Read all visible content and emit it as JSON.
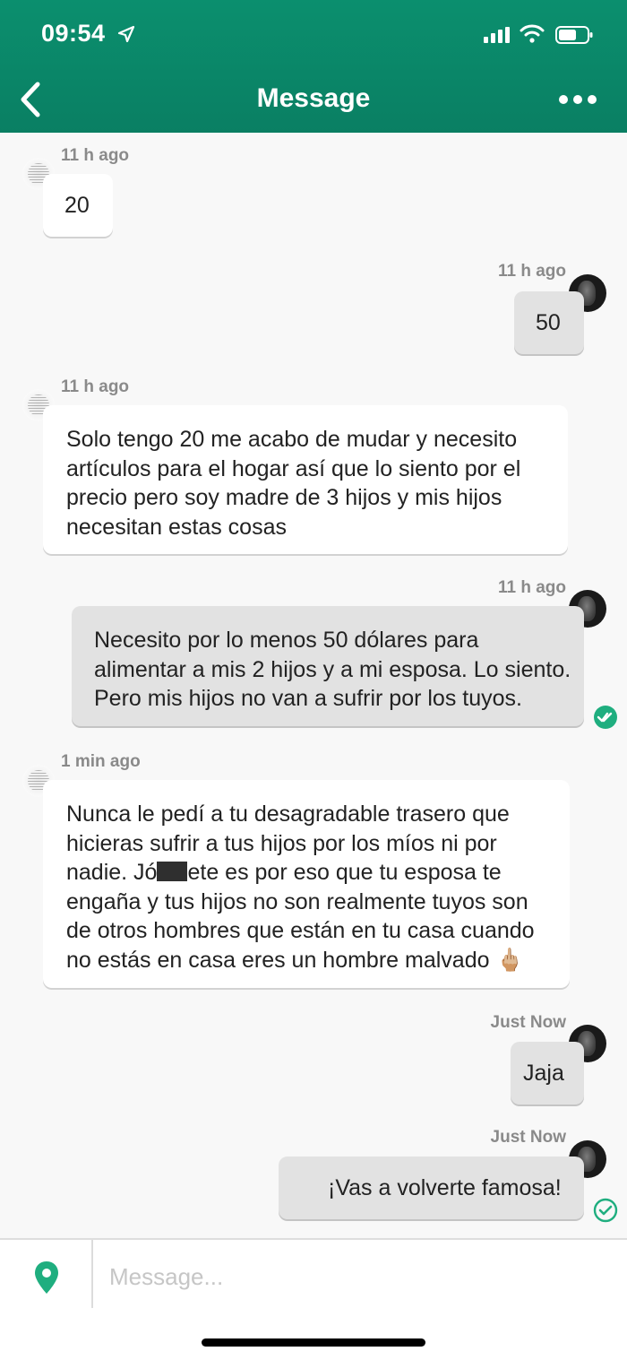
{
  "status_bar": {
    "time": "09:54"
  },
  "header": {
    "title": "Message"
  },
  "messages": [
    {
      "side": "in",
      "time": "11 h ago",
      "text": "20"
    },
    {
      "side": "out",
      "time": "11 h ago",
      "text": "50"
    },
    {
      "side": "in",
      "time": "11 h ago",
      "lines": [
        "Solo tengo 20 me acabo de mudar y necesito",
        "artículos para el hogar así que lo siento por el",
        "precio pero soy madre de 3 hijos y mis hijos",
        "necesitan estas cosas"
      ]
    },
    {
      "side": "out",
      "time": "11 h ago",
      "lines": [
        "Necesito por lo menos 50 dólares para",
        "alimentar a mis 2 hijos y a mi esposa. Lo siento.",
        "Pero mis hijos no van a sufrir por los tuyos."
      ],
      "status": "read"
    },
    {
      "side": "in",
      "time": "1 min ago",
      "lines": [
        "Nunca le pedí a tu desagradable trasero que",
        "hicieras sufrir a tus hijos por los míos ni por",
        "nadie. Jó",
        "ete es por eso que tu esposa te",
        "engaña y tus hijos no son realmente tuyos son",
        "de otros hombres que están en tu casa cuando",
        "no estás en casa eres un hombre malvado",
        "🖕🏼"
      ]
    },
    {
      "side": "out",
      "time": "Just Now",
      "text": "Jaja"
    },
    {
      "side": "out",
      "time": "Just Now",
      "text": "¡Vas a volverte famosa!",
      "status": "sent"
    }
  ],
  "composer": {
    "placeholder": "Message..."
  },
  "colors": {
    "header": "#0a8a6a",
    "accent_green": "#1fae7f"
  },
  "icons": [
    "location-arrow-icon",
    "signal-icon",
    "wifi-icon",
    "battery-icon",
    "back-chevron-icon",
    "more-dots-icon",
    "double-check-icon",
    "check-icon",
    "location-pin-icon"
  ]
}
